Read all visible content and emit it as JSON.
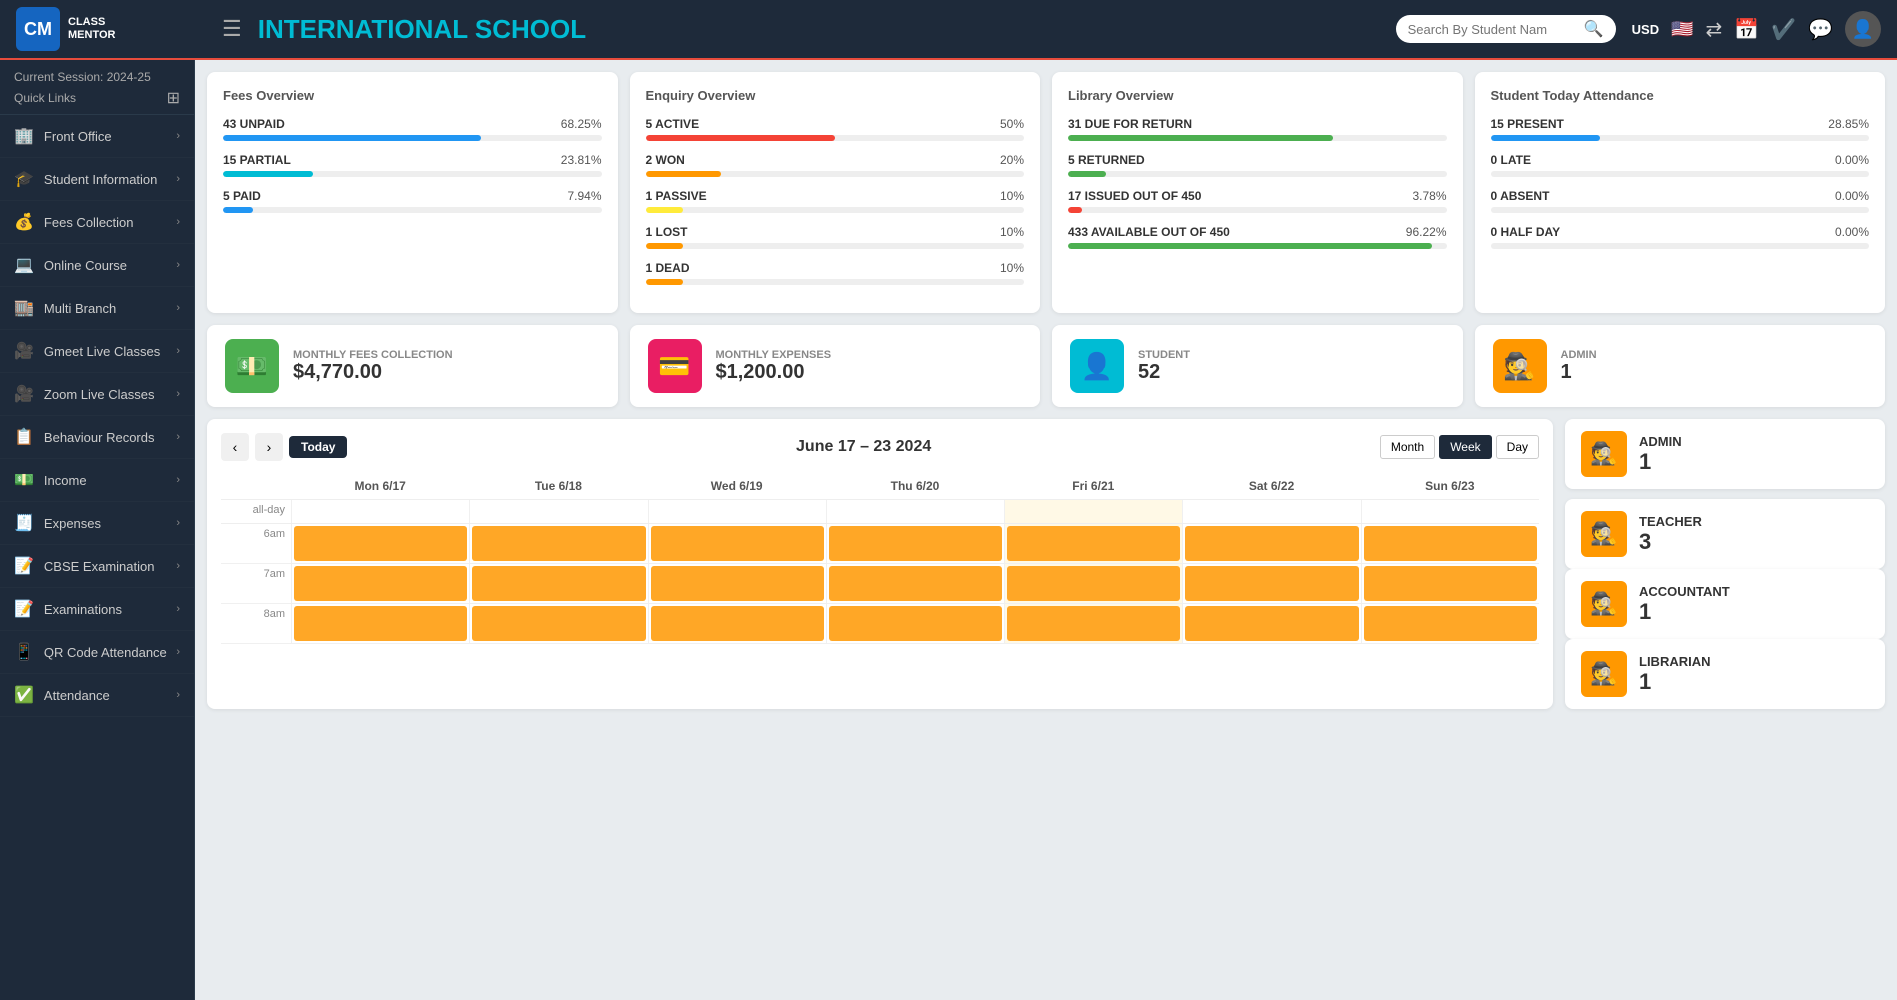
{
  "navbar": {
    "logo_letters": "CM",
    "logo_line1": "CLASS",
    "logo_line2": "MENTOR",
    "school_name": "INTERNATIONAL SCHOOL",
    "search_placeholder": "Search By Student Nam",
    "currency": "USD"
  },
  "sidebar": {
    "session": "Current Session: 2024-25",
    "quick_links": "Quick Links",
    "items": [
      {
        "label": "Front Office",
        "icon": "🏢"
      },
      {
        "label": "Student Information",
        "icon": "🎓"
      },
      {
        "label": "Fees Collection",
        "icon": "💰"
      },
      {
        "label": "Online Course",
        "icon": "💻"
      },
      {
        "label": "Multi Branch",
        "icon": "🏬"
      },
      {
        "label": "Gmeet Live Classes",
        "icon": "🎥"
      },
      {
        "label": "Zoom Live Classes",
        "icon": "🎥"
      },
      {
        "label": "Behaviour Records",
        "icon": "📋"
      },
      {
        "label": "Income",
        "icon": "💵"
      },
      {
        "label": "Expenses",
        "icon": "🧾"
      },
      {
        "label": "CBSE Examination",
        "icon": "📝"
      },
      {
        "label": "Examinations",
        "icon": "📝"
      },
      {
        "label": "QR Code Attendance",
        "icon": "📱"
      },
      {
        "label": "Attendance",
        "icon": "✅"
      }
    ]
  },
  "fees_overview": {
    "title": "Fees Overview",
    "items": [
      {
        "label": "43 UNPAID",
        "pct": "68.25%",
        "pct_val": 68.25,
        "color": "#2196f3"
      },
      {
        "label": "15 PARTIAL",
        "pct": "23.81%",
        "pct_val": 23.81,
        "color": "#00bcd4"
      },
      {
        "label": "5 PAID",
        "pct": "7.94%",
        "pct_val": 7.94,
        "color": "#2196f3"
      }
    ]
  },
  "enquiry_overview": {
    "title": "Enquiry Overview",
    "items": [
      {
        "label": "5 ACTIVE",
        "pct": "50%",
        "pct_val": 50,
        "color": "#f44336"
      },
      {
        "label": "2 WON",
        "pct": "20%",
        "pct_val": 20,
        "color": "#ff9800"
      },
      {
        "label": "1 PASSIVE",
        "pct": "10%",
        "pct_val": 10,
        "color": "#ffeb3b"
      },
      {
        "label": "1 LOST",
        "pct": "10%",
        "pct_val": 10,
        "color": "#ff9800"
      },
      {
        "label": "1 DEAD",
        "pct": "10%",
        "pct_val": 10,
        "color": "#ff9800"
      }
    ]
  },
  "library_overview": {
    "title": "Library Overview",
    "items": [
      {
        "label": "31 DUE FOR RETURN",
        "pct": "",
        "pct_val": 70,
        "color": "#4caf50"
      },
      {
        "label": "5 RETURNED",
        "pct": "",
        "pct_val": 10,
        "color": "#4caf50"
      },
      {
        "label": "17 ISSUED OUT OF 450",
        "pct": "3.78%",
        "pct_val": 3.78,
        "color": "#f44336"
      },
      {
        "label": "433 AVAILABLE OUT OF 450",
        "pct": "96.22%",
        "pct_val": 96.22,
        "color": "#4caf50"
      }
    ]
  },
  "attendance_overview": {
    "title": "Student Today Attendance",
    "items": [
      {
        "label": "15 PRESENT",
        "pct": "28.85%",
        "pct_val": 28.85,
        "color": "#2196f3"
      },
      {
        "label": "0 LATE",
        "pct": "0.00%",
        "pct_val": 0,
        "color": "#4caf50"
      },
      {
        "label": "0 ABSENT",
        "pct": "0.00%",
        "pct_val": 0,
        "color": "#f44336"
      },
      {
        "label": "0 HALF DAY",
        "pct": "0.00%",
        "pct_val": 0,
        "color": "#ff9800"
      }
    ]
  },
  "metrics": [
    {
      "label": "MONTHLY FEES COLLECTION",
      "value": "$4,770.00",
      "icon": "💵",
      "color_class": "green"
    },
    {
      "label": "MONTHLY EXPENSES",
      "value": "$1,200.00",
      "icon": "💳",
      "color_class": "pink"
    },
    {
      "label": "STUDENT",
      "value": "52",
      "icon": "👤",
      "color_class": "teal"
    },
    {
      "label": "ADMIN",
      "value": "1",
      "icon": "🕵️",
      "color_class": "orange"
    }
  ],
  "calendar": {
    "title": "June 17 – 23 2024",
    "today_label": "Today",
    "view_month": "Month",
    "view_week": "Week",
    "view_day": "Day",
    "days": [
      "Mon 6/17",
      "Tue 6/18",
      "Wed 6/19",
      "Thu 6/20",
      "Fri 6/21",
      "Sat 6/22",
      "Sun 6/23"
    ],
    "times": [
      "6am",
      "7am",
      "8am"
    ],
    "allday_label": "all-day"
  },
  "people": [
    {
      "role": "TEACHER",
      "count": "3",
      "icon": "🕵️"
    },
    {
      "role": "ACCOUNTANT",
      "count": "1",
      "icon": "🕵️"
    },
    {
      "role": "LIBRARIAN",
      "count": "1",
      "icon": "🕵️"
    }
  ]
}
